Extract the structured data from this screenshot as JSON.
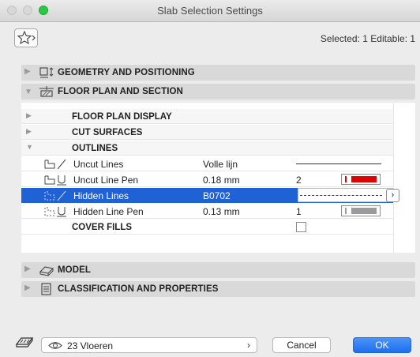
{
  "window": {
    "title": "Slab Selection Settings"
  },
  "header": {
    "selected_info": "Selected: 1 Editable: 1"
  },
  "sections": [
    {
      "label": "GEOMETRY AND POSITIONING",
      "expanded": false
    },
    {
      "label": "FLOOR PLAN AND SECTION",
      "expanded": true
    },
    {
      "label": "MODEL",
      "expanded": false
    },
    {
      "label": "CLASSIFICATION AND PROPERTIES",
      "expanded": false
    }
  ],
  "floor_plan": {
    "groups": [
      {
        "label": "FLOOR PLAN DISPLAY",
        "expanded": false
      },
      {
        "label": "CUT SURFACES",
        "expanded": false
      },
      {
        "label": "OUTLINES",
        "expanded": true
      }
    ],
    "outlines": [
      {
        "name": "Uncut Lines",
        "value": "Volle lijn",
        "preview": "solid-line"
      },
      {
        "name": "Uncut Line Pen",
        "value": "0.18 mm",
        "pen_number": "2",
        "pen_color": "#e00000"
      },
      {
        "name": "Hidden Lines",
        "value": "B0702",
        "preview": "dashed-line",
        "selected": true
      },
      {
        "name": "Hidden Line Pen",
        "value": "0.13 mm",
        "pen_number": "1",
        "pen_color": "#9a9a9a"
      }
    ],
    "cover_fills_label": "COVER FILLS",
    "cover_fills_checked": false
  },
  "footer": {
    "layer_value": "23 Vloeren",
    "cancel_label": "Cancel",
    "ok_label": "OK"
  },
  "colors": {
    "accent": "#1f62d6",
    "ok_button": "#2f80f5"
  }
}
